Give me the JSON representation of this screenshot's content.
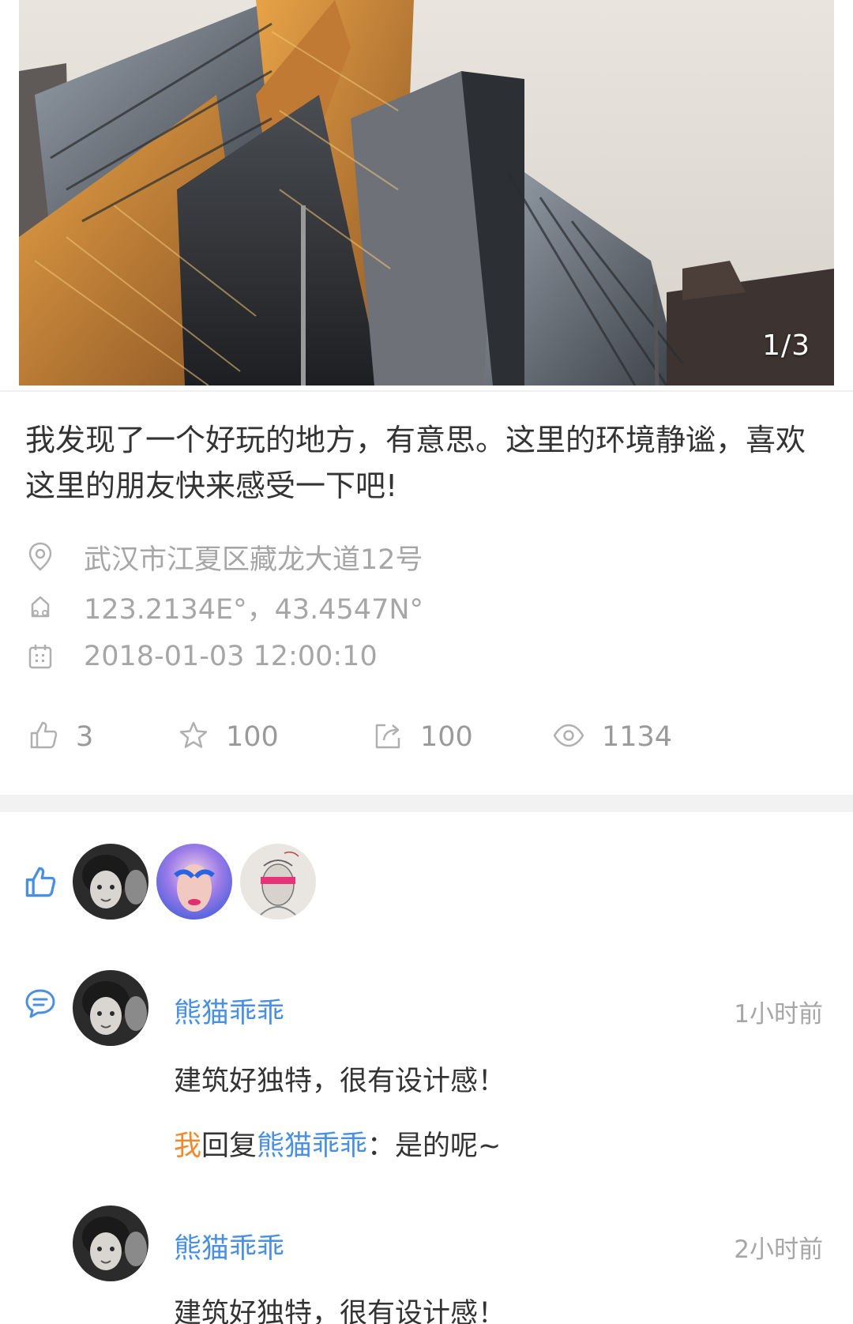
{
  "hero": {
    "counter": "1/3"
  },
  "post": {
    "text": "我发现了一个好玩的地方，有意思。这里的环境静谧，喜欢这里的朋友快来感受一下吧!",
    "address": "武汉市江夏区藏龙大道12号",
    "coordinates": "123.2134E°，43.4547N°",
    "datetime": "2018-01-03 12:00:10"
  },
  "stats": {
    "likes": "3",
    "favorites": "100",
    "shares": "100",
    "views": "1134"
  },
  "likers": [
    {
      "avatar": "avatar-boy"
    },
    {
      "avatar": "avatar-makeup"
    },
    {
      "avatar": "avatar-sketch"
    }
  ],
  "comments": [
    {
      "author": "熊猫乖乖",
      "time": "1小时前",
      "text": "建筑好独特，很有设计感！",
      "reply": {
        "from": "我",
        "verb": "回复",
        "to": "熊猫乖乖",
        "text": "：是的呢~"
      }
    },
    {
      "author": "熊猫乖乖",
      "time": "2小时前",
      "text": "建筑好独特，很有设计感！"
    }
  ],
  "colors": {
    "link_blue": "#4a90e2",
    "me_orange": "#f08a2c",
    "muted_gray": "#a6a6a6",
    "icon_gray": "#b0b0b0"
  }
}
